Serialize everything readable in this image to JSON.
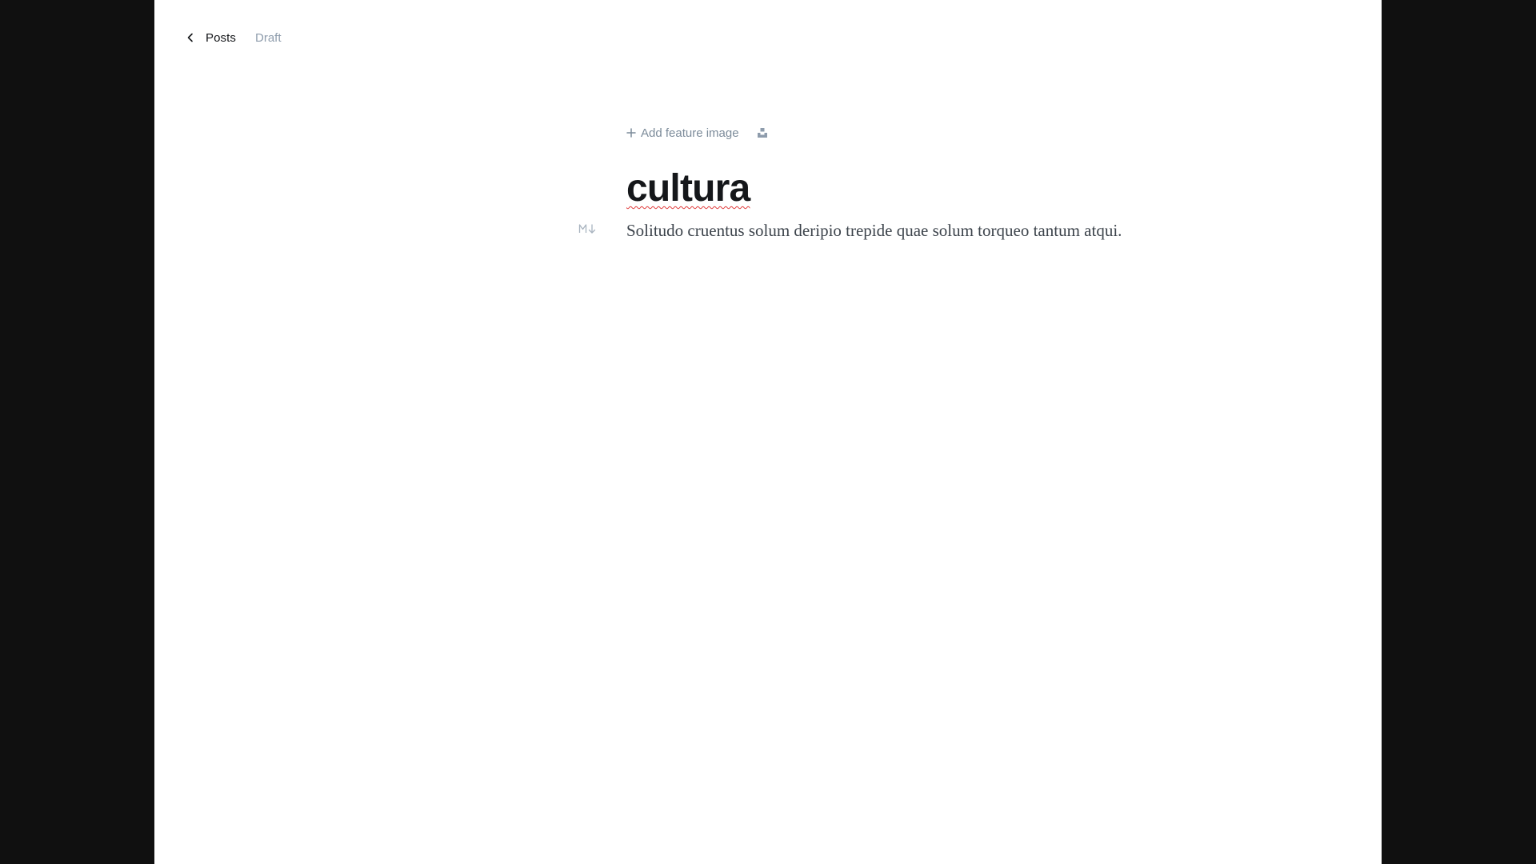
{
  "nav": {
    "back_label": "Posts",
    "status": "Draft"
  },
  "feature": {
    "add_label": "Add feature image"
  },
  "post": {
    "title": "cultura",
    "body": "Solitudo cruentus solum deripio trepide quae solum torqueo tantum atqui."
  },
  "colors": {
    "background_outer": "#101010",
    "canvas": "#ffffff",
    "muted": "#8e9cac",
    "title": "#15171a",
    "body": "#3c434b",
    "spellcheck": "#e03b3b"
  },
  "icons": {
    "back": "chevron-left-icon",
    "add": "plus-icon",
    "unsplash": "unsplash-icon",
    "markdown": "markdown-icon"
  }
}
